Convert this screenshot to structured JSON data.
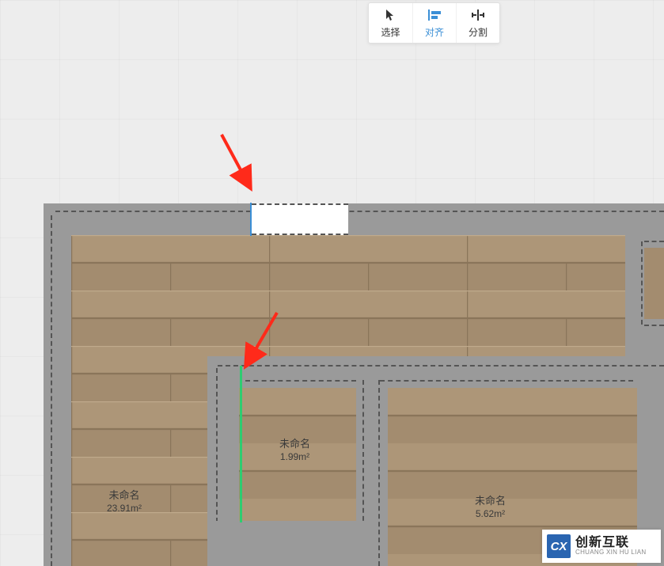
{
  "toolbar": {
    "select": "选择",
    "align": "对齐",
    "split": "分割",
    "active": "align"
  },
  "rooms": {
    "r1": {
      "name": "未命名",
      "area": "23.91m²"
    },
    "r2": {
      "name": "未命名",
      "area": "1.99m²"
    },
    "r3": {
      "name": "未命名",
      "area": "5.62m²"
    }
  },
  "watermark": {
    "logo": "CX",
    "cn": "创新互联",
    "en": "CHUANG XIN HU LIAN"
  },
  "colors": {
    "accent": "#3b8fd6",
    "highlight": "#2ecc71",
    "arrow": "#ff2a1a",
    "wall": "#9a9a9a"
  }
}
